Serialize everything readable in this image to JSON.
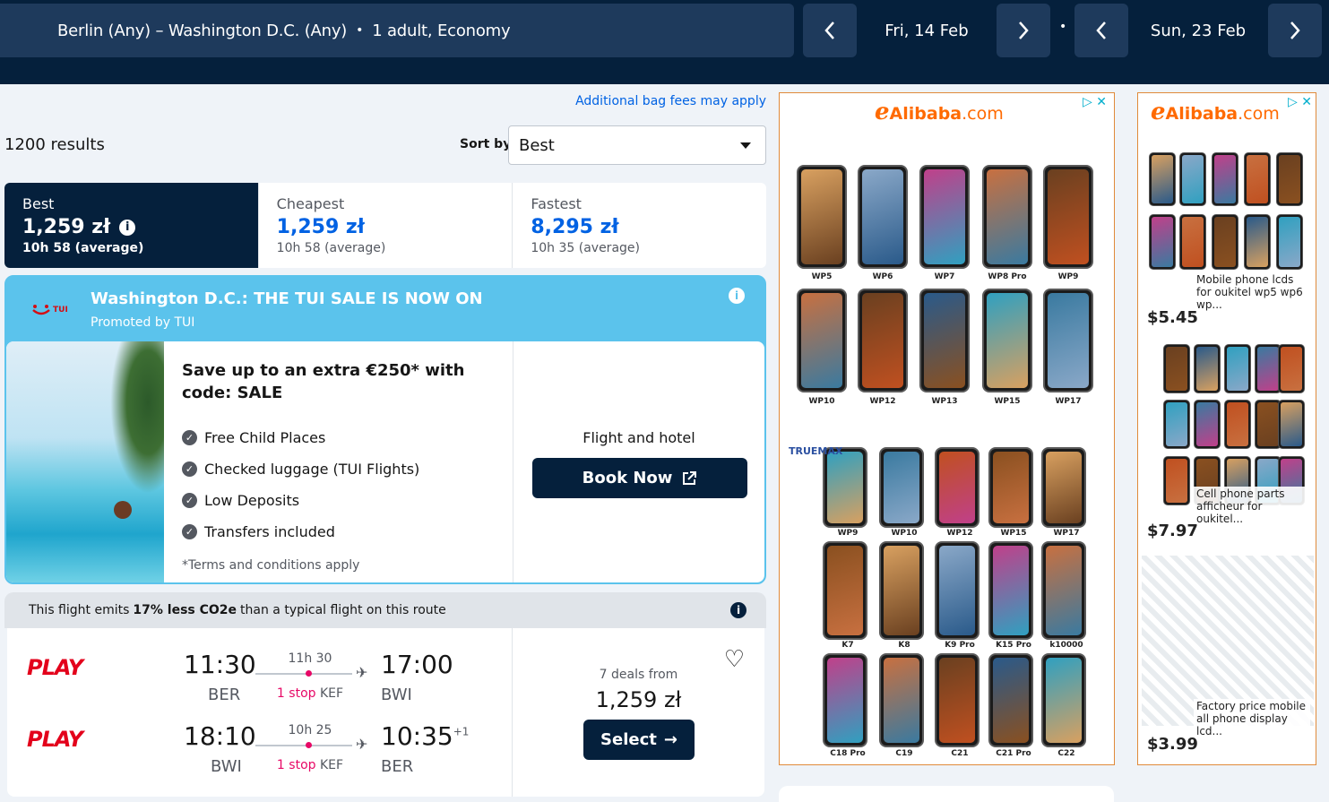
{
  "header": {
    "route": "Berlin (Any) – Washington D.C. (Any)",
    "sep": "•",
    "passengers": "1 adult, Economy",
    "depart_date": "Fri, 14 Feb",
    "return_date": "Sun, 23 Feb"
  },
  "results": {
    "bag_fees_link": "Additional bag fees may apply",
    "count": "1200 results",
    "sort_label": "Sort by",
    "sort_value": "Best"
  },
  "tabs": [
    {
      "title": "Best",
      "price": "1,259 zł",
      "duration": "10h 58 (average)"
    },
    {
      "title": "Cheapest",
      "price": "1,259 zł",
      "duration": "10h 58 (average)"
    },
    {
      "title": "Fastest",
      "price": "8,295 zł",
      "duration": "10h 35 (average)"
    }
  ],
  "promo": {
    "logo_text": "TUI",
    "title": "Washington D.C.: THE TUI SALE IS NOW ON",
    "promoted_by": "Promoted by TUI",
    "heading": "Save up to an extra €250* with code: SALE",
    "features": [
      "Free Child Places",
      "Checked luggage (TUI Flights)",
      "Low Deposits",
      "Transfers included"
    ],
    "terms": "*Terms and conditions apply",
    "product_label": "Flight and hotel",
    "cta": "Book Now"
  },
  "eco": {
    "prefix": "This flight emits",
    "highlight": "17% less CO2e",
    "suffix": "than a typical flight on this route"
  },
  "flight": {
    "outbound": {
      "airline": "PLAY",
      "dep_time": "11:30",
      "dep_code": "BER",
      "duration": "11h 30",
      "stops": "1 stop",
      "via": "KEF",
      "arr_time": "17:00",
      "arr_code": "BWI",
      "day_offset": ""
    },
    "inbound": {
      "airline": "PLAY",
      "dep_time": "18:10",
      "dep_code": "BWI",
      "duration": "10h 25",
      "stops": "1 stop",
      "via": "KEF",
      "arr_time": "10:35",
      "arr_code": "BER",
      "day_offset": "+1"
    },
    "deals": "7 deals from",
    "price": "1,259 zł",
    "select": "Select"
  },
  "ad_left": {
    "brand": "Alibaba",
    "brand_suffix": ".com",
    "models_row1": [
      "WP5",
      "WP6",
      "WP7",
      "WP8 Pro",
      "WP9"
    ],
    "models_row2": [
      "WP10",
      "WP12",
      "WP13",
      "WP15",
      "WP17"
    ],
    "section_brand": "TRUEMAX",
    "models_row3": [
      "WP9",
      "WP10",
      "WP12",
      "WP15",
      "WP17"
    ],
    "models_row4": [
      "K7",
      "K8",
      "K9 Pro",
      "K15 Pro",
      "k10000"
    ],
    "models_row5": [
      "C18 Pro",
      "C19",
      "C21",
      "C21 Pro",
      "C22"
    ]
  },
  "ad_right": {
    "brand": "Alibaba",
    "brand_suffix": ".com",
    "items": [
      {
        "caption": "Mobile phone lcds for oukitel wp5 wp6 wp...",
        "price": "$5.45"
      },
      {
        "caption": "Cell phone parts afficheur for oukitel...",
        "price": "$7.97"
      },
      {
        "caption": "Factory price mobile all phone display lcd...",
        "price": "$3.99"
      }
    ]
  },
  "colors": {
    "navy": "#05203c",
    "accent": "#0062e3",
    "promo": "#5bc3ec",
    "stop": "#e70866",
    "play": "#e3001b",
    "alibaba": "#ff6a00"
  }
}
